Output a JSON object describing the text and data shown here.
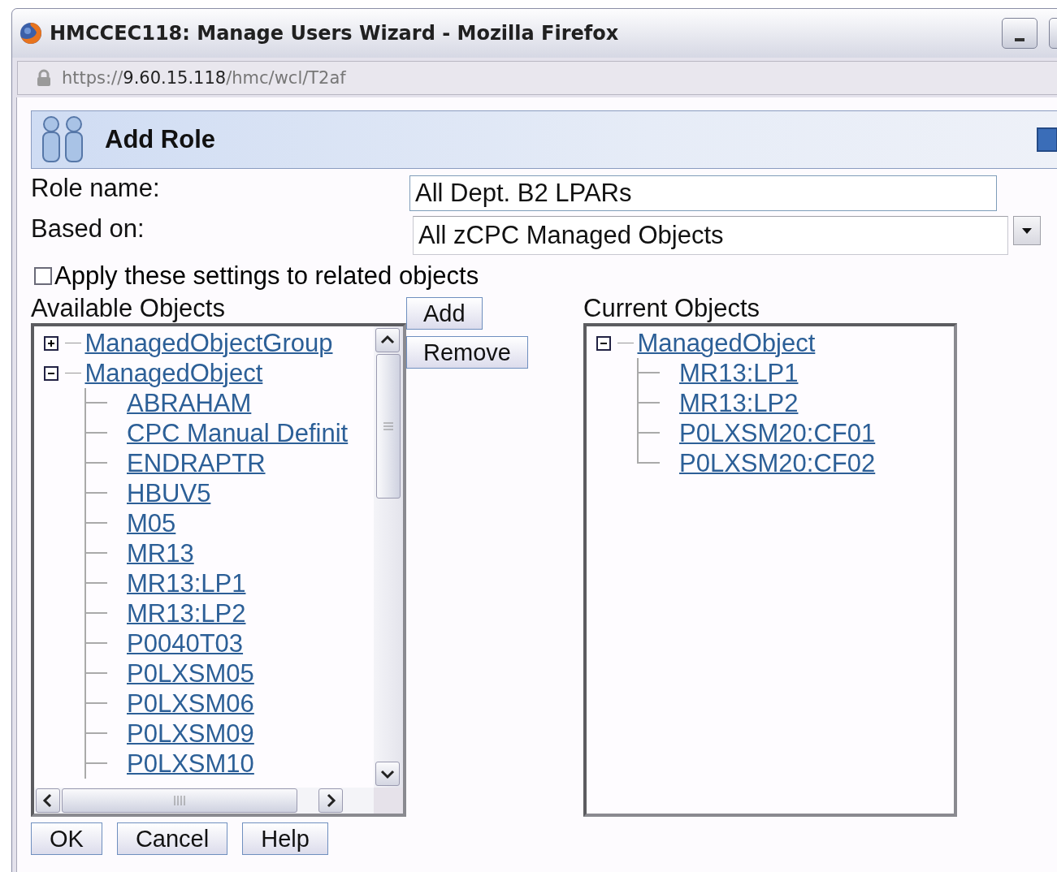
{
  "window": {
    "title": "HMCCEC118: Manage Users Wizard - Mozilla Firefox"
  },
  "address_bar": {
    "scheme": "https://",
    "host": "9.60.15.118",
    "path": "/hmc/wcl/T2af"
  },
  "header": {
    "title": "Add Role"
  },
  "form": {
    "role_name": {
      "label": "Role name:",
      "value": "All Dept. B2 LPARs"
    },
    "based_on": {
      "label": "Based on:",
      "value": "All zCPC Managed Objects"
    },
    "apply_related": {
      "label": "Apply these settings to related objects",
      "checked": false
    }
  },
  "available_objects": {
    "label": "Available Objects",
    "tree": [
      {
        "label": "ManagedObjectGroup",
        "expanded": false
      },
      {
        "label": "ManagedObject",
        "expanded": true,
        "children": [
          {
            "label": "ABRAHAM"
          },
          {
            "label": "CPC Manual Definit"
          },
          {
            "label": "ENDRAPTR"
          },
          {
            "label": "HBUV5"
          },
          {
            "label": "M05"
          },
          {
            "label": "MR13"
          },
          {
            "label": "MR13:LP1"
          },
          {
            "label": "MR13:LP2"
          },
          {
            "label": "P0040T03"
          },
          {
            "label": "P0LXSM05"
          },
          {
            "label": "P0LXSM06"
          },
          {
            "label": "P0LXSM09"
          },
          {
            "label": "P0LXSM10"
          }
        ]
      }
    ]
  },
  "move_buttons": [
    "Add",
    "Remove"
  ],
  "current_objects": {
    "label": "Current Objects",
    "tree": [
      {
        "label": "ManagedObject",
        "expanded": true,
        "children": [
          {
            "label": "MR13:LP1"
          },
          {
            "label": "MR13:LP2"
          },
          {
            "label": "P0LXSM20:CF01"
          },
          {
            "label": "P0LXSM20:CF02"
          }
        ]
      }
    ]
  },
  "buttons": [
    "OK",
    "Cancel",
    "Help"
  ]
}
